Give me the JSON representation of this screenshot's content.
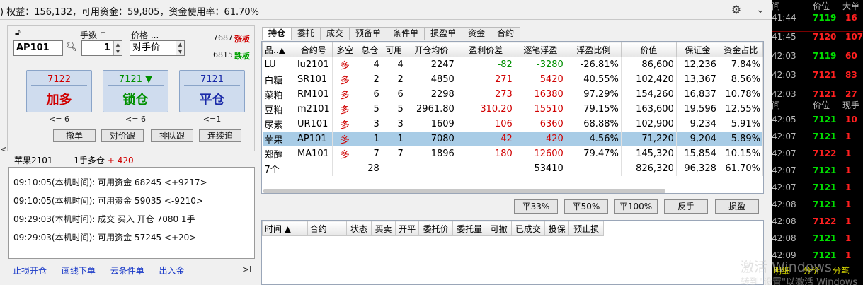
{
  "topbar": {
    "summary": ")  权益：156,132，可用资金：59,805，资金使用率：61.70%",
    "settings_icon": "gear-icon",
    "collapse_icon": "chevron-down-icon"
  },
  "order": {
    "qty_label": "手数",
    "price_label": "价格 ...",
    "contract": "AP101",
    "qty": "1",
    "price": "对手价",
    "limit_up_price": "7687",
    "limit_up_label": "涨板",
    "limit_down_price": "6815",
    "limit_down_label": "跌板",
    "buttons": [
      {
        "price": "7122",
        "action": "加多",
        "caption": "<= 6"
      },
      {
        "price": "7121 ▼",
        "action": "锁仓",
        "caption": "<= 6"
      },
      {
        "price": "7121",
        "action": "平仓",
        "caption": "<=1"
      }
    ],
    "small_buttons": [
      "撤单",
      "对价跟",
      "排队跟",
      "连续追"
    ]
  },
  "selected": {
    "name": "苹果2101",
    "position": "1手多仓",
    "pl": "+ 420"
  },
  "log": [
    "09:10:05(本机时间): 可用资金 68245  <+9217>",
    "09:10:05(本机时间): 可用资金 59035  <-9210>",
    "09:29:03(本机时间): 成交  买入  开仓  7080  1手",
    "09:29:03(本机时间): 可用资金 57245  <+20>"
  ],
  "links": [
    "止损开仓",
    "画线下单",
    "云条件单",
    "出入金"
  ],
  "links_end": ">I",
  "tabs": [
    "持仓",
    "委托",
    "成交",
    "预备单",
    "条件单",
    "损盈单",
    "资金",
    "合约"
  ],
  "positions": {
    "headers": [
      "品..▲",
      "合约号",
      "多空",
      "总仓",
      "可用",
      "开仓均价",
      "盈利价差",
      "逐笔浮盈",
      "浮盈比例",
      "价值",
      "保证金",
      "资金占比"
    ],
    "rows": [
      {
        "name": "LU",
        "contract": "lu2101",
        "dir": "多",
        "total": "4",
        "avail": "4",
        "open": "2247",
        "diff": "-82",
        "float": "-3280",
        "ratio": "-26.81%",
        "value": "86,600",
        "margin": "12,236",
        "share": "7.84%"
      },
      {
        "name": "白糖",
        "contract": "SR101",
        "dir": "多",
        "total": "2",
        "avail": "2",
        "open": "4850",
        "diff": "271",
        "float": "5420",
        "ratio": "40.55%",
        "value": "102,420",
        "margin": "13,367",
        "share": "8.56%"
      },
      {
        "name": "菜粕",
        "contract": "RM101",
        "dir": "多",
        "total": "6",
        "avail": "6",
        "open": "2298",
        "diff": "273",
        "float": "16380",
        "ratio": "97.29%",
        "value": "154,260",
        "margin": "16,837",
        "share": "10.78%"
      },
      {
        "name": "豆粕",
        "contract": "m2101",
        "dir": "多",
        "total": "5",
        "avail": "5",
        "open": "2961.80",
        "diff": "310.20",
        "float": "15510",
        "ratio": "79.15%",
        "value": "163,600",
        "margin": "19,596",
        "share": "12.55%"
      },
      {
        "name": "尿素",
        "contract": "UR101",
        "dir": "多",
        "total": "3",
        "avail": "3",
        "open": "1609",
        "diff": "106",
        "float": "6360",
        "ratio": "68.88%",
        "value": "102,900",
        "margin": "9,234",
        "share": "5.91%"
      },
      {
        "name": "苹果",
        "contract": "AP101",
        "dir": "多",
        "total": "1",
        "avail": "1",
        "open": "7080",
        "diff": "42",
        "float": "420",
        "ratio": "4.56%",
        "value": "71,220",
        "margin": "9,204",
        "share": "5.89%"
      },
      {
        "name": "郑醇",
        "contract": "MA101",
        "dir": "多",
        "total": "7",
        "avail": "7",
        "open": "1896",
        "diff": "180",
        "float": "12600",
        "ratio": "79.47%",
        "value": "145,320",
        "margin": "15,854",
        "share": "10.15%"
      }
    ],
    "total_row": {
      "name": "7个",
      "total": "28",
      "float": "53410",
      "value": "826,320",
      "margin": "96,328",
      "share": "61.70%"
    }
  },
  "action_buttons": [
    "平33%",
    "平50%",
    "平100%",
    "反手",
    "损盈"
  ],
  "orders": {
    "headers": [
      "时间 ▲",
      "合约",
      "状态",
      "买卖",
      "开平",
      "委托价",
      "委托量",
      "可撤",
      "已成交",
      "投保",
      "预止损"
    ]
  },
  "market": {
    "head1": [
      "间",
      "价位",
      "大单"
    ],
    "rows1": [
      {
        "t": "41:44",
        "p": "7119",
        "v": "16"
      },
      {
        "t": "41:45",
        "p": "7120",
        "v": "107"
      },
      {
        "t": "42:03",
        "p": "7119",
        "v": "60"
      },
      {
        "t": "42:03",
        "p": "7121",
        "v": "83"
      },
      {
        "t": "42:03",
        "p": "7121",
        "v": "27"
      }
    ],
    "head2": [
      "间",
      "价位",
      "现手"
    ],
    "rows2": [
      {
        "t": "42:05",
        "p": "7121",
        "v": "10"
      },
      {
        "t": "42:07",
        "p": "7121",
        "v": "1"
      },
      {
        "t": "42:07",
        "p": "7122",
        "v": "1"
      },
      {
        "t": "42:07",
        "p": "7121",
        "v": "1"
      },
      {
        "t": "42:07",
        "p": "7121",
        "v": "1"
      },
      {
        "t": "42:08",
        "p": "7121",
        "v": "1"
      },
      {
        "t": "42:08",
        "p": "7122",
        "v": "1"
      },
      {
        "t": "42:08",
        "p": "7121",
        "v": "1"
      },
      {
        "t": "42:09",
        "p": "7121",
        "v": "1"
      }
    ],
    "footer_tabs": [
      "明细",
      "分价",
      "分笔"
    ]
  },
  "watermark": {
    "line1": "激活 Windows",
    "line2": "转到\"设置\"以激活 Windows"
  }
}
